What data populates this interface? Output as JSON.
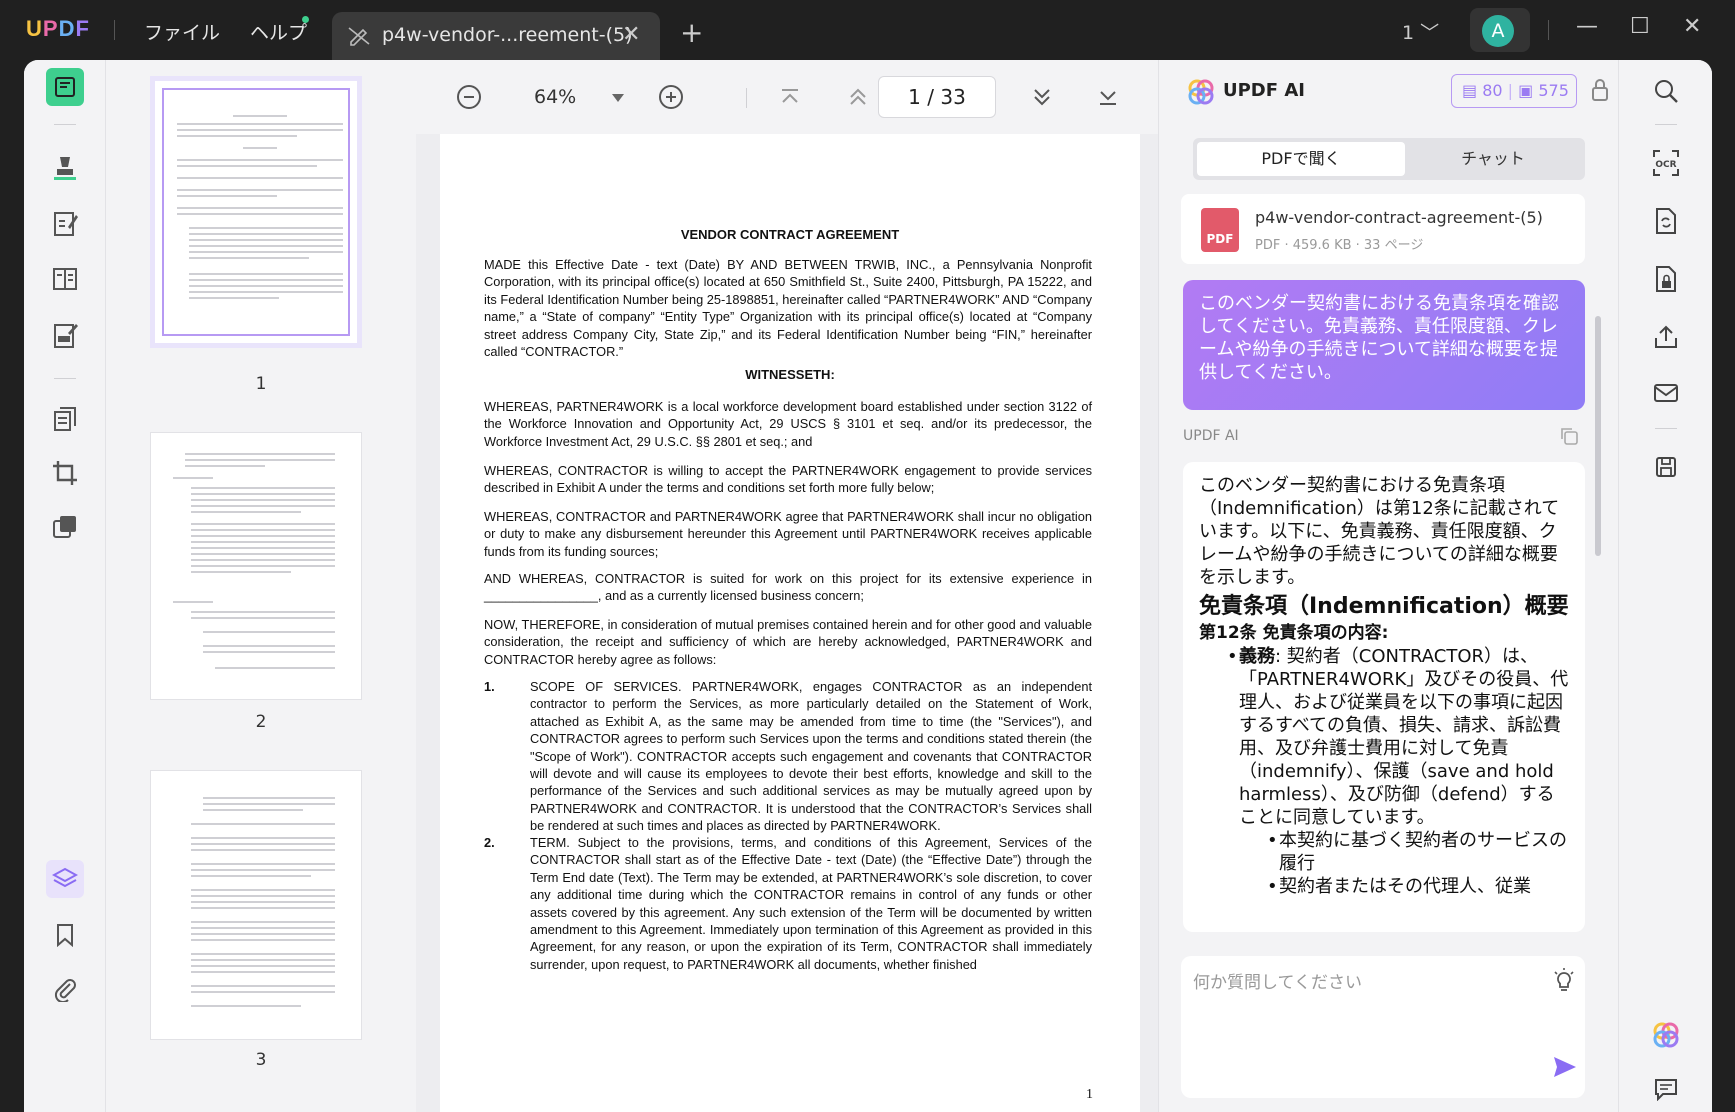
{
  "titlebar": {
    "logo": [
      "U",
      "P",
      "D",
      "F"
    ],
    "menu": [
      "ファイル",
      "ヘルプ"
    ],
    "tab_label": "p4w-vendor-...reement-(5)",
    "tab_close": "✕",
    "new_tab": "+",
    "page_selector": "1 ﹀",
    "avatar_letter": "A",
    "minimize": "—",
    "maximize": "☐",
    "close": "✕"
  },
  "thumbnails": [
    {
      "number": "1"
    },
    {
      "number": "2"
    },
    {
      "number": "3"
    }
  ],
  "viewer": {
    "zoom": "64%",
    "page_indicator": "1 / 33"
  },
  "document": {
    "title": "VENDOR CONTRACT AGREEMENT",
    "intro": "MADE this Effective Date - text (Date) BY AND BETWEEN TRWIB, INC., a Pennsylvania Nonprofit Corporation, with its principal office(s) located at 650 Smithfield St., Suite 2400, Pittsburgh, PA 15222, and its Federal Identification Number being 25-1898851, hereinafter called “PARTNER4WORK” AND “Company name,” a “State of company” “Entity Type” Organization with its principal office(s) located at “Company street address Company City, State Zip,” and its Federal Identification Number being “FIN,” hereinafter called “CONTRACTOR.”",
    "witnesseth": "WITNESSETH:",
    "whereas1": "WHEREAS, PARTNER4WORK is a local workforce development board established under section 3122 of the Workforce Innovation and Opportunity Act, 29 USCS § 3101 et seq. and/or its predecessor, the Workforce Investment Act, 29 U.S.C. §§ 2801 et seq.; and",
    "whereas2": "WHEREAS, CONTRACTOR is willing to accept the PARTNER4WORK engagement to provide services described in Exhibit A under the terms and conditions set forth more fully below;",
    "whereas3": "WHEREAS, CONTRACTOR and PARTNER4WORK agree that PARTNER4WORK shall incur no obligation or duty to make any disbursement hereunder this Agreement until PARTNER4WORK receives applicable funds from its funding sources;",
    "whereas4": "AND WHEREAS, CONTRACTOR is suited for work on this project for its extensive experience in ________________, and as a currently licensed business concern;",
    "now_therefore": "NOW, THEREFORE, in consideration of mutual premises contained herein and for other good and valuable consideration, the receipt and sufficiency of which are hereby acknowledged, PARTNER4WORK and CONTRACTOR hereby agree as follows:",
    "sec1_num": "1.",
    "sec1": "SCOPE OF SERVICES. PARTNER4WORK, engages CONTRACTOR as an independent contractor to perform the Services, as more particularly detailed on the Statement of Work, attached as Exhibit A, as the same may be amended from time to time (the \"Services\"), and CONTRACTOR agrees to perform such Services upon the terms and conditions stated therein (the \"Scope of Work\"). CONTRACTOR accepts such engagement and covenants that CONTRACTOR will devote and will cause its employees to devote their best efforts, knowledge and skill to the performance of the Services and such additional services as may be mutually agreed upon by PARTNER4WORK and CONTRACTOR. It is understood that the CONTRACTOR’s Services shall be rendered at such times and places as directed by PARTNER4WORK.",
    "sec2_num": "2.",
    "sec2": "TERM. Subject to the provisions, terms, and conditions of this Agreement, Services of the CONTRACTOR shall start as of the Effective Date - text (Date) (the “Effective Date”) through the Term End date (Text). The Term may be extended, at PARTNER4WORK’s sole discretion, to cover any additional time during which the CONTRACTOR remains in control of any funds or other assets covered by this agreement. Any such extension of the Term will be documented by written amendment to this Agreement. Immediately upon termination of this Agreement as provided in this Agreement, for any reason, or upon the expiration of its Term, CONTRACTOR shall immediately surrender, upon request, to PARTNER4WORK all documents, whether finished",
    "page_number": "1"
  },
  "ai_panel": {
    "title": "UPDF AI",
    "credits_doc": "80",
    "credits_chat": "575",
    "tab_pdf": "PDFで聞く",
    "tab_chat": "チャット",
    "file_icon_text": "PDF",
    "file_name": "p4w-vendor-contract-agreement-(5)",
    "file_meta": "PDF · 459.6 KB · 33 ページ",
    "user_question": "このベンダー契約書における免責条項を確認してください。免責義務、責任限度額、クレームや紛争の手続きについて詳細な概要を提供してください。",
    "answer_label": "UPDF AI",
    "answer_intro": "このベンダー契約書における免責条項（Indemnification）は第12条に記載されています。以下に、免責義務、責任限度額、クレームや紛争の手続きについての詳細な概要を示します。",
    "answer_heading": "免責条項（Indemnification）概要",
    "answer_sub": "第12条 免責条項の内容:",
    "duty_label": "義務",
    "duty_text": ": 契約者（CONTRACTOR）は、「PARTNER4WORK」及びその役員、代理人、および従業員を以下の事項に起因するすべての負債、損失、請求、訴訟費用、及び弁護士費用に対して免責（indemnify）、保護（save and hold harmless）、及び防御（defend）することに同意しています。",
    "sub_items": [
      "本契約に基づく契約者のサービスの履行",
      "契約者またはその代理人、従業"
    ],
    "input_placeholder": "何か質問してください"
  }
}
